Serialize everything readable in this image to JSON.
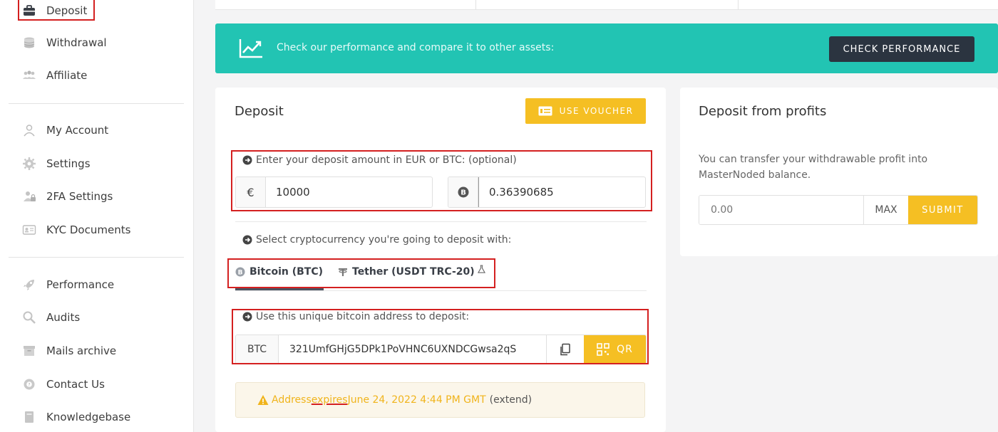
{
  "sidebar": {
    "items": [
      {
        "label": "Deposit",
        "icon": "briefcase-icon"
      },
      {
        "label": "Withdrawal",
        "icon": "coins-icon"
      },
      {
        "label": "Affiliate",
        "icon": "users-icon"
      },
      {
        "label": "My Account",
        "icon": "user-icon"
      },
      {
        "label": "Settings",
        "icon": "gear-icon"
      },
      {
        "label": "2FA Settings",
        "icon": "user-lock-icon"
      },
      {
        "label": "KYC Documents",
        "icon": "id-card-icon"
      },
      {
        "label": "Performance",
        "icon": "rocket-icon"
      },
      {
        "label": "Audits",
        "icon": "magnifier-icon"
      },
      {
        "label": "Mails archive",
        "icon": "archive-icon"
      },
      {
        "label": "Contact Us",
        "icon": "support-icon"
      },
      {
        "label": "Knowledgebase",
        "icon": "book-icon"
      }
    ]
  },
  "banner": {
    "text": "Check our performance and compare it to other assets:",
    "button_label": "CHECK PERFORMANCE",
    "color": "#22c4b3"
  },
  "deposit": {
    "title": "Deposit",
    "voucher_label": "USE VOUCHER",
    "amount_label": "Enter your deposit amount in EUR or BTC: (optional)",
    "eur_symbol": "€",
    "eur_value": "10000",
    "btc_value": "0.36390685",
    "crypto_label": "Select cryptocurrency you're going to deposit with:",
    "tabs": [
      {
        "label": "Bitcoin (BTC)",
        "icon": "bitcoin-icon"
      },
      {
        "label": "Tether (USDT TRC-20)",
        "icon": "tether-icon"
      }
    ],
    "address_label": "Use this unique bitcoin address to deposit:",
    "address_prefix": "BTC",
    "address": "321UmfGHjG5DPk1PoVHNC6UXNDCGwsa2qS",
    "qr_label": "QR",
    "warning_prefix": "Address ",
    "warning_expires": "expires",
    "warning_date": " June 24, 2022 4:44 PM GMT",
    "warning_extend": "(extend)"
  },
  "profits": {
    "title": "Deposit from profits",
    "description": "You can transfer your withdrawable profit into MasterNoded balance.",
    "amount_placeholder": "0.00",
    "max_label": "MAX",
    "submit_label": "SUBMIT"
  },
  "colors": {
    "accent_yellow": "#f5bf23",
    "dark_button": "#2b3440",
    "highlight_red": "#d42020"
  }
}
